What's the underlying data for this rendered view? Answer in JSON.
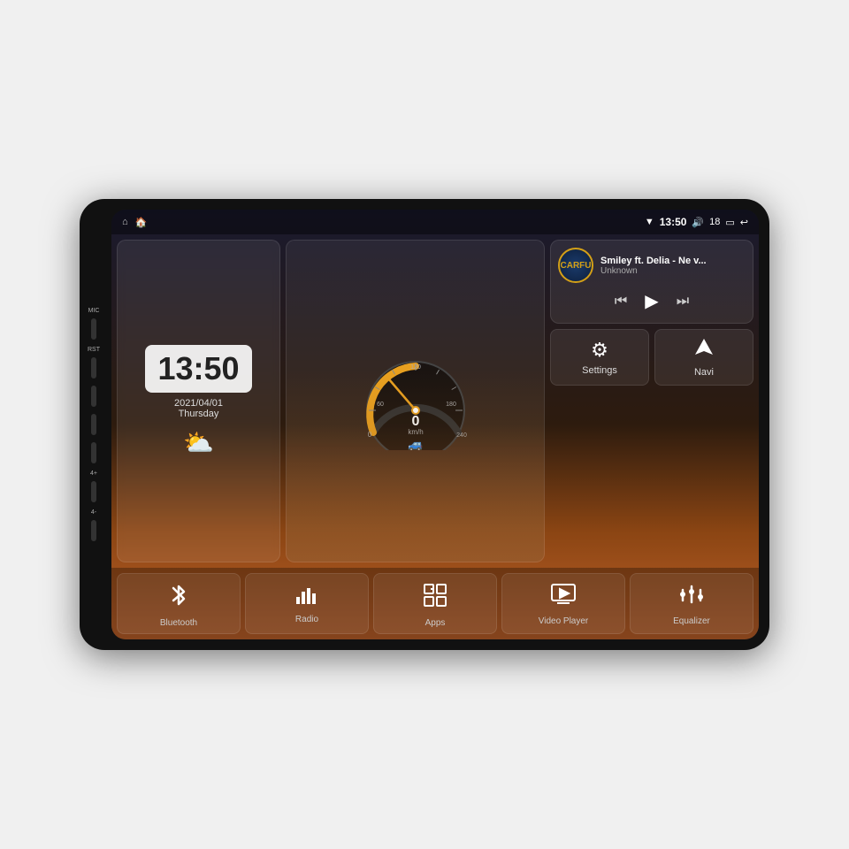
{
  "device": {
    "bg": "#111"
  },
  "status_bar": {
    "left": {
      "home_icon": "⌂",
      "house_icon": "🏠"
    },
    "time": "13:50",
    "volume": "18",
    "wifi_icon": "▼",
    "battery_icon": "▭",
    "back_icon": "↩"
  },
  "clock_widget": {
    "time": "13:50",
    "date": "2021/04/01",
    "day": "Thursday",
    "weather": "⛅"
  },
  "music_widget": {
    "title": "Smiley ft. Delia - Ne v...",
    "artist": "Unknown",
    "logo": "CARFU"
  },
  "action_buttons": [
    {
      "icon": "⚙",
      "label": "Settings"
    },
    {
      "icon": "⬡",
      "label": "Navi"
    }
  ],
  "nav_buttons": [
    {
      "icon": "✱",
      "label": "Bluetooth"
    },
    {
      "icon": "📊",
      "label": "Radio"
    },
    {
      "icon": "⊞",
      "label": "Apps"
    },
    {
      "icon": "▶",
      "label": "Video Player"
    },
    {
      "icon": "⚌",
      "label": "Equalizer"
    }
  ],
  "side_buttons": [
    {
      "label": "MIC"
    },
    {
      "label": "RST"
    },
    {
      "label": ""
    },
    {
      "label": ""
    },
    {
      "label": ""
    },
    {
      "label": "4+"
    },
    {
      "label": "4-"
    }
  ]
}
